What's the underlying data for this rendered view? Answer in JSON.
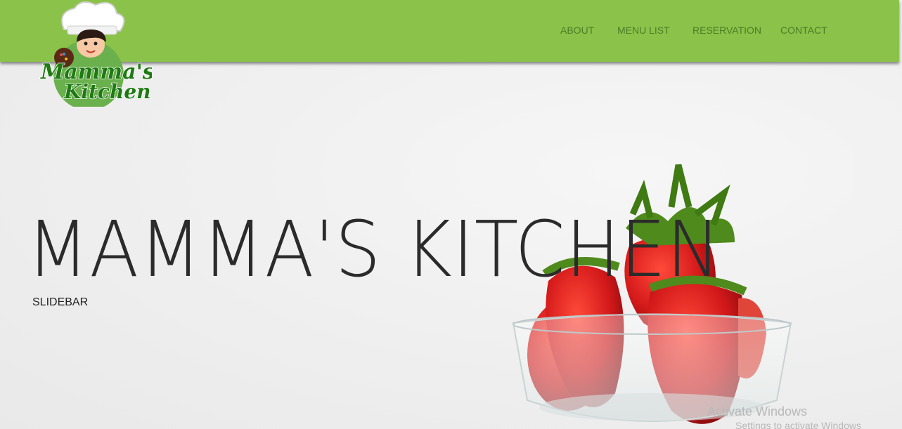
{
  "brand": {
    "logo_line1": "Mamma's",
    "logo_line2": "Kitchen"
  },
  "nav": {
    "items": [
      "ABOUT",
      "MENU LIST",
      "RESERVATION",
      "CONTACT"
    ]
  },
  "hero": {
    "title": "MAMMA'S KITCHEN",
    "subtitle": "SLIDEBAR"
  },
  "os_watermark": {
    "line1": "Activate Windows",
    "line2": "Settings to activate Windows"
  },
  "colors": {
    "navbar": "#8bc34a",
    "nav_text": "#4a7d26",
    "title": "#2b2b2b"
  }
}
